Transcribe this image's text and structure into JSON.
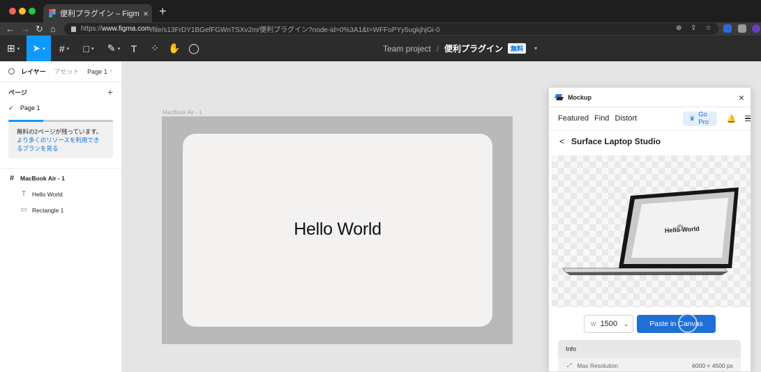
{
  "browser": {
    "tab_title": "便利プラグイン – Figma",
    "tab_close": "×",
    "new_tab": "+",
    "url_prefix": "https://",
    "url_host": "www.figma.com",
    "url_path": "/file/s13FrDY1BGefFGWnTSXv2m/便利プラグイン?node-id=0%3A1&t=WFFoPYy5ugkjhjGi-0",
    "nav_icons": [
      "back-icon",
      "forward-icon",
      "reload-icon",
      "home-icon"
    ],
    "accent_colors": {
      "close": "#ff5f57",
      "minimize": "#febc2e",
      "maximize": "#28c840"
    }
  },
  "toolbar": {
    "text_tool_label": "T",
    "team": "Team project",
    "separator": "/",
    "file_name": "便利プラグイン",
    "plan_badge": "無料",
    "active_tool": "move",
    "accent": "#0d99ff"
  },
  "sidebar": {
    "tab_layers": "レイヤー",
    "tab_assets": "アセット",
    "page_selector": "Page 1",
    "pages_header": "ページ",
    "add_page": "+",
    "pages": [
      {
        "label": "Page 1",
        "selected": true
      }
    ],
    "upsell": {
      "text": "無料の2ページが残っています。",
      "link": "より多くのリソースを利用できるプランを見る",
      "progress_fraction": 0.33
    },
    "layers": [
      {
        "name": "MacBook Air - 1",
        "type": "frame",
        "icon": "frame-icon"
      },
      {
        "name": "Hello World",
        "type": "text",
        "icon": "text-icon"
      },
      {
        "name": "Rectangle 1",
        "type": "rectangle",
        "icon": "rectangle-icon"
      }
    ]
  },
  "canvas": {
    "frame_label": "MacBook Air - 1",
    "hello_text": "Hello World"
  },
  "plugin": {
    "name": "Mockup",
    "close": "×",
    "nav": [
      "Featured",
      "Find",
      "Distort"
    ],
    "go_pro": "Go Pro",
    "device_title": "Surface Laptop Studio",
    "back": "<",
    "preview_text": "Hello World",
    "width_label": "W",
    "width_value": "1500",
    "paste_button": "Paste in Canvas",
    "info_header": "Info",
    "info_rows": [
      {
        "label": "Max Resolution",
        "value": "6000 × 4500 px"
      }
    ],
    "button_color": "#1f6fd6"
  }
}
